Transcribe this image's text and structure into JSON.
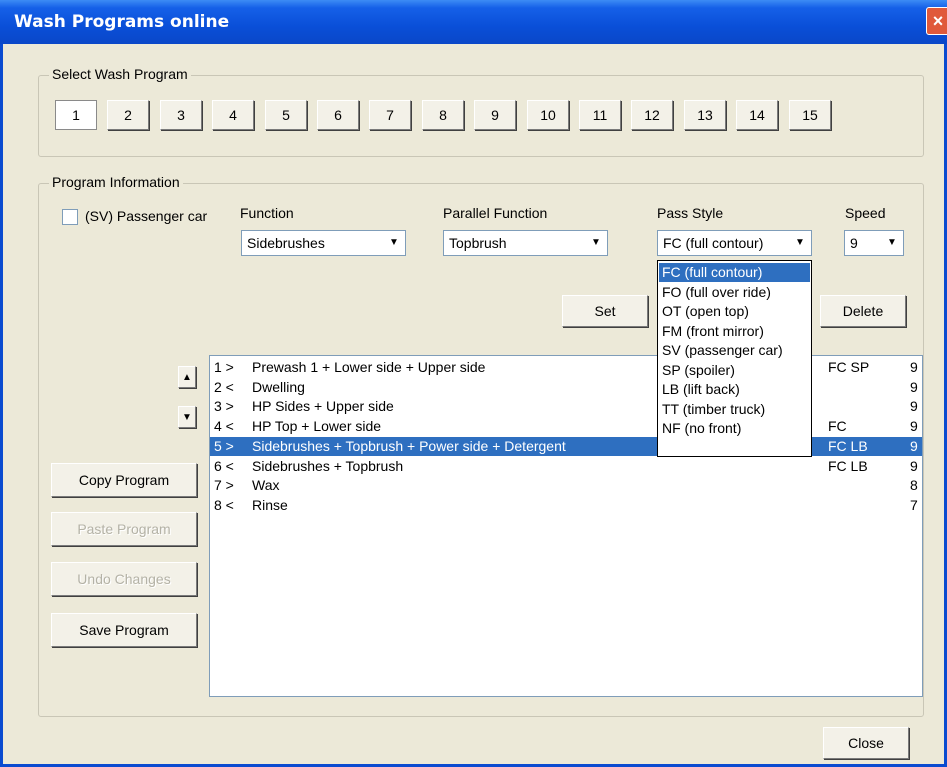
{
  "window": {
    "title": "Wash Programs online",
    "close_glyph": "×"
  },
  "select_group": {
    "legend": "Select Wash Program",
    "programs": [
      "1",
      "2",
      "3",
      "4",
      "5",
      "6",
      "7",
      "8",
      "9",
      "10",
      "11",
      "12",
      "13",
      "14",
      "15"
    ],
    "selected": "1"
  },
  "info_group": {
    "legend": "Program Information",
    "passenger_checkbox": {
      "label": "(SV) Passenger car",
      "checked": false
    },
    "function": {
      "label": "Function",
      "value": "Sidebrushes"
    },
    "parallel_function": {
      "label": "Parallel Function",
      "value": "Topbrush"
    },
    "pass_style": {
      "label": "Pass Style",
      "value": "FC (full contour)"
    },
    "speed": {
      "label": "Speed",
      "value": "9"
    },
    "set_label": "Set",
    "delete_label": "Delete"
  },
  "pass_style_options": [
    "FC (full contour)",
    "FO (full over ride)",
    "OT (open top)",
    "FM (front mirror)",
    "SV (passenger car)",
    "SP (spoiler)",
    "LB (lift back)",
    "TT (timber truck)",
    "NF (no front)"
  ],
  "steps": [
    {
      "num": "1 >",
      "desc": "Prewash 1 + Lower side + Upper side",
      "style": "FC SP",
      "speed": "9"
    },
    {
      "num": "2 <",
      "desc": "Dwelling",
      "style": "",
      "speed": "9"
    },
    {
      "num": "3 >",
      "desc": "HP Sides + Upper side",
      "style": "",
      "speed": "9"
    },
    {
      "num": "4 <",
      "desc": "HP Top + Lower side",
      "style": "FC",
      "speed": "9"
    },
    {
      "num": "5 >",
      "desc": "Sidebrushes + Topbrush + Power side + Detergent",
      "style": "FC LB",
      "speed": "9"
    },
    {
      "num": "6 <",
      "desc": "Sidebrushes + Topbrush",
      "style": "FC LB",
      "speed": "9"
    },
    {
      "num": "7 >",
      "desc": "Wax",
      "style": "",
      "speed": "8"
    },
    {
      "num": "8 <",
      "desc": "Rinse",
      "style": "",
      "speed": "7"
    }
  ],
  "selected_step": "5 >",
  "side_buttons": {
    "copy": "Copy Program",
    "paste": "Paste Program",
    "undo": "Undo Changes",
    "save": "Save Program"
  },
  "close_label": "Close",
  "icons": {
    "up": "up-arrow-icon",
    "down": "down-arrow-icon",
    "dropdown": "chevron-down-icon"
  },
  "colors": {
    "title_bar": "#0a4fd8",
    "selection": "#2e6fc0"
  }
}
